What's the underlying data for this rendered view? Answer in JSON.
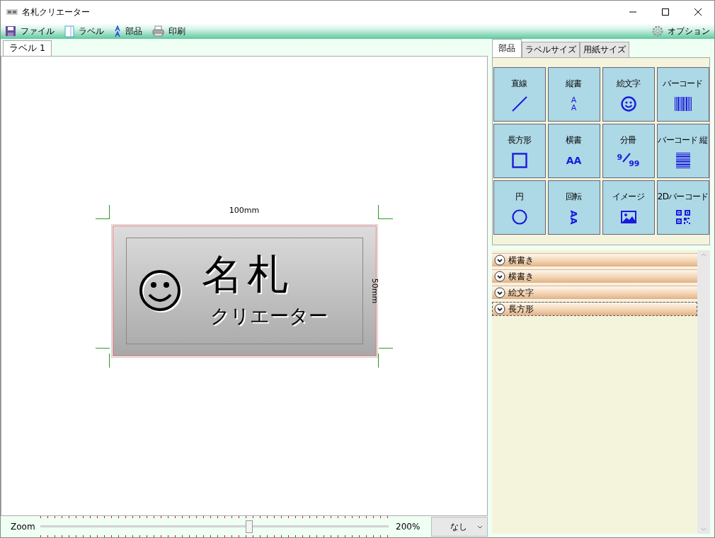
{
  "window": {
    "title": "名札クリエーター"
  },
  "toolbar": [
    {
      "label": "ファイル",
      "kind": "save"
    },
    {
      "label": "ラベル",
      "kind": "page"
    },
    {
      "label": "部品",
      "kind": "parts"
    },
    {
      "label": "印刷",
      "kind": "print"
    }
  ],
  "options": {
    "label": "オプション"
  },
  "document_tabs": [
    {
      "label": "ラベル 1",
      "selected": true
    }
  ],
  "label": {
    "width": "100mm",
    "height": "50mm",
    "title": "名札",
    "subtitle": "クリエーター"
  },
  "zoom": {
    "label": "Zoom",
    "level": 0.6,
    "reading": "200%"
  },
  "dropdown": {
    "value": "なし"
  },
  "panel_tabs": [
    {
      "label": "部品",
      "selected": true
    },
    {
      "label": "ラベルサイズ",
      "selected": false
    },
    {
      "label": "用紙サイズ",
      "selected": false
    }
  ],
  "parts": [
    {
      "label": "直線",
      "kind": "line"
    },
    {
      "label": "縦書",
      "kind": "vtext",
      "glyph": "AA"
    },
    {
      "label": "絵文字",
      "kind": "emoji"
    },
    {
      "label": "バーコード",
      "kind": "barcode"
    },
    {
      "label": "長方形",
      "kind": "rect"
    },
    {
      "label": "横書",
      "kind": "htext",
      "glyph": "AA"
    },
    {
      "label": "分冊",
      "kind": "fraction",
      "glyph": "9",
      "glyph2": "99"
    },
    {
      "label": "バーコード 縦",
      "kind": "vbarcode"
    },
    {
      "label": "円",
      "kind": "circle"
    },
    {
      "label": "回転",
      "kind": "rotate",
      "glyph": "AA"
    },
    {
      "label": "イメージ",
      "kind": "image"
    },
    {
      "label": "2Dバーコード",
      "kind": "qr"
    }
  ],
  "layers": [
    {
      "label": "横書き",
      "selected": false
    },
    {
      "label": "横書き",
      "selected": false
    },
    {
      "label": "絵文字",
      "selected": false
    },
    {
      "label": "長方形",
      "selected": true
    }
  ]
}
